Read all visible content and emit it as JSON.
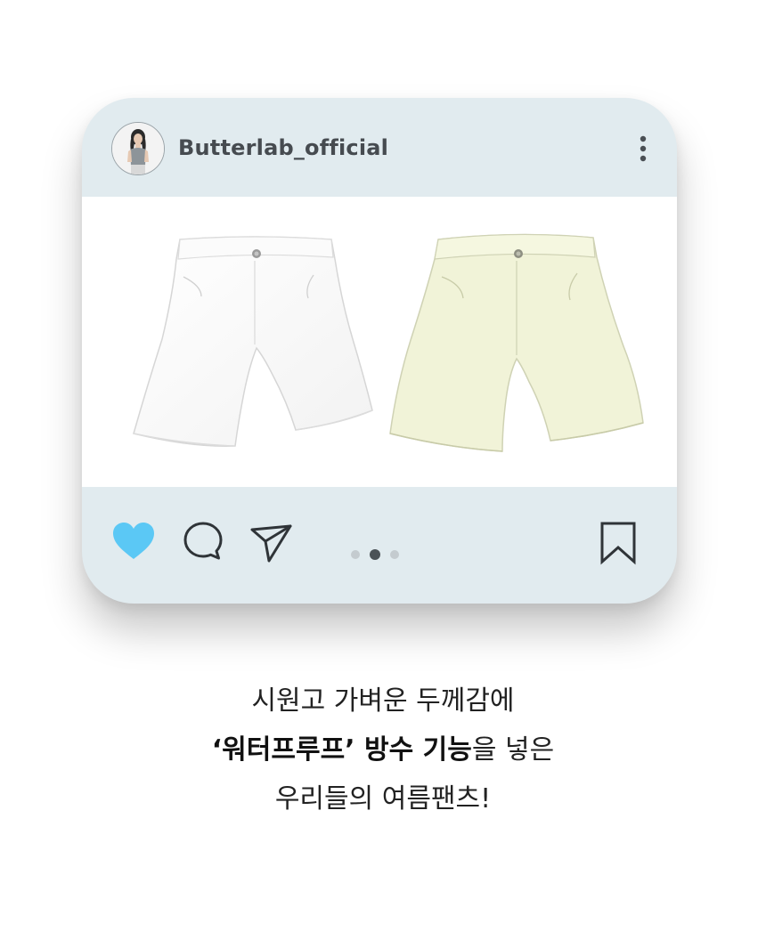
{
  "post": {
    "username": "Butterlab_official",
    "carousel": {
      "count": 3,
      "active_index": 1
    },
    "products": [
      {
        "name": "white-shorts",
        "color": "#ffffff"
      },
      {
        "name": "cream-shorts",
        "color": "#f1f3d9"
      }
    ]
  },
  "actions": {
    "like_icon": "heart-icon",
    "like_color": "#5bc8f5",
    "comment_icon": "comment-icon",
    "share_icon": "send-icon",
    "save_icon": "bookmark-icon"
  },
  "colors": {
    "card_bg": "#e1ebef",
    "accent": "#5bc8f5"
  },
  "caption": {
    "line1": "시원고 가벼운 두께감에",
    "line2_bold": "‘워터프루프’ 방수 기능",
    "line2_rest": "을 넣은",
    "line3": "우리들의 여름팬츠!"
  }
}
